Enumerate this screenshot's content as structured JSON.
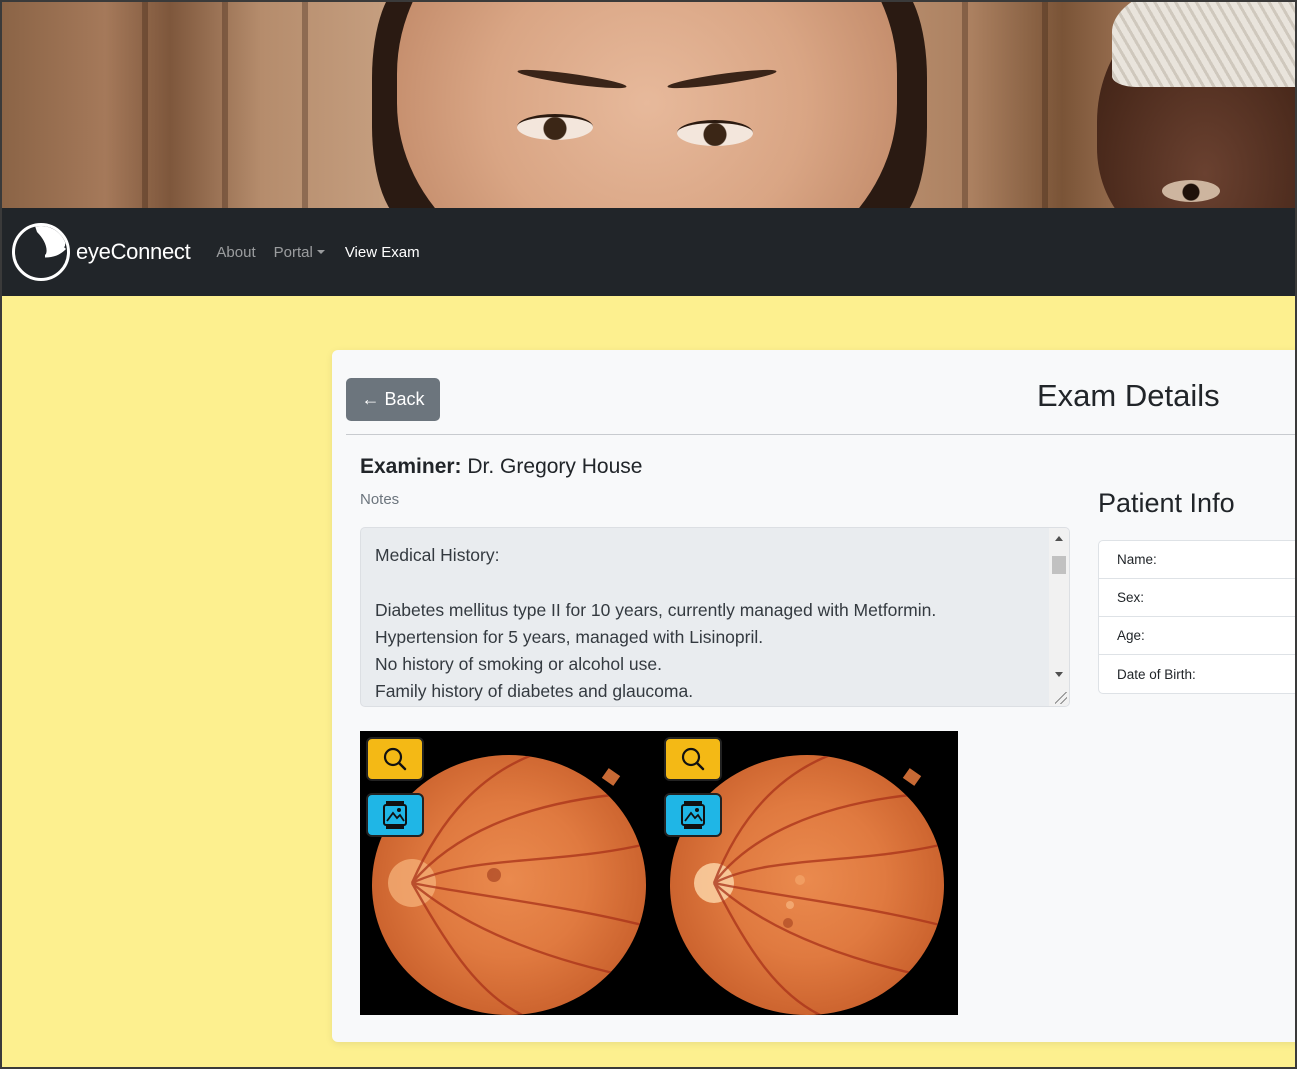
{
  "navbar": {
    "brand": "eyeConnect",
    "links": [
      {
        "label": "About",
        "active": false
      },
      {
        "label": "Portal",
        "active": false,
        "dropdown": true
      },
      {
        "label": "View Exam",
        "active": true
      }
    ]
  },
  "exam": {
    "back_label": "← Back",
    "title": "Exam Details",
    "examiner_label": "Examiner:",
    "examiner_name": "Dr. Gregory House",
    "notes_label": "Notes",
    "notes_text": "Medical History:\n\nDiabetes mellitus type II for 10 years, currently managed with Metformin.\nHypertension for 5 years, managed with Lisinopril.\nNo history of smoking or alcohol use.\nFamily history of diabetes and glaucoma.",
    "images": [
      {
        "zoom_icon": "search-icon",
        "view_icon": "image-icon"
      },
      {
        "zoom_icon": "search-icon",
        "view_icon": "image-icon"
      }
    ]
  },
  "patient": {
    "title": "Patient Info",
    "fields": [
      {
        "label": "Name:"
      },
      {
        "label": "Sex:"
      },
      {
        "label": "Age:"
      },
      {
        "label": "Date of Birth:"
      }
    ]
  },
  "colors": {
    "page_bg": "#fdf08f",
    "navbar_bg": "#212529",
    "back_button": "#6c757d",
    "zoom_button": "#f4b915",
    "view_button": "#1fb6e6"
  }
}
